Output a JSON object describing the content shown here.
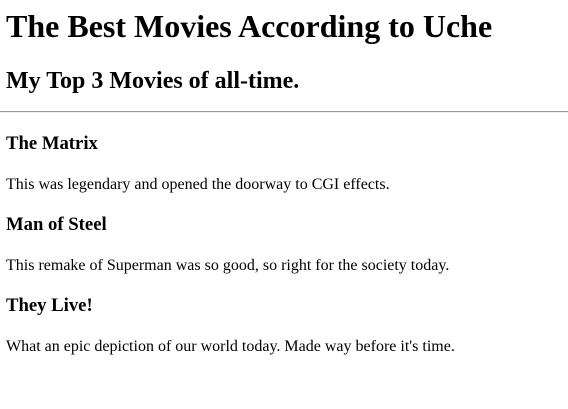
{
  "page": {
    "title": "The Best Movies According to Uche",
    "subtitle": "My Top 3 Movies of all-time."
  },
  "movies": [
    {
      "title": "The Matrix",
      "description": "This was legendary and opened the doorway to CGI effects."
    },
    {
      "title": "Man of Steel",
      "description": "This remake of Superman was so good, so right for the society today."
    },
    {
      "title": "They Live!",
      "description": "What an epic depiction of our world today. Made way before it's time."
    }
  ]
}
